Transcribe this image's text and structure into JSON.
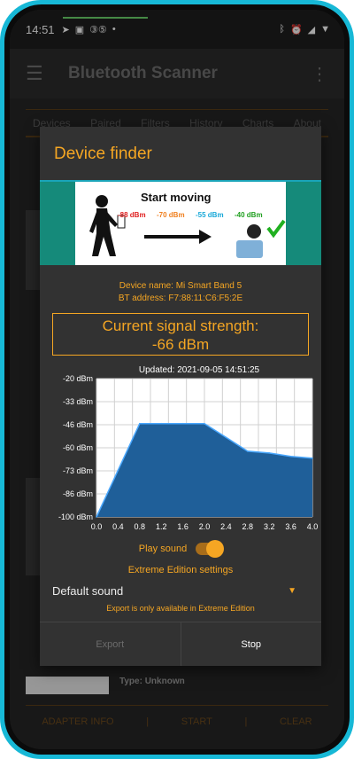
{
  "status_bar": {
    "time": "14:51",
    "left_icons": [
      "send-icon",
      "sim-icon",
      "data-35-icon",
      "dot-icon"
    ],
    "right_icons": [
      "bluetooth-icon",
      "alarm-icon",
      "signal-icon",
      "wifi-icon"
    ]
  },
  "app_bar": {
    "title": "Bluetooth Scanner"
  },
  "tabs": [
    "Devices",
    "Paired",
    "Filters",
    "History",
    "Charts",
    "About"
  ],
  "bottom_bar": {
    "adapter_info": "ADAPTER INFO",
    "start": "START",
    "clear": "CLEAR"
  },
  "background": {
    "type_label": "Type: Unknown"
  },
  "dialog": {
    "title": "Device finder",
    "banner": {
      "heading": "Start moving",
      "dbm_values": [
        "-88 dBm",
        "-70 dBm",
        "-55 dBm",
        "-40 dBm"
      ],
      "dbm_colors": [
        "#e02020",
        "#f08020",
        "#18a8d8",
        "#20a020"
      ]
    },
    "device_name": "Device name: Mi Smart Band 5",
    "bt_address": "BT address: F7:88:11:C6:F5:2E",
    "signal_label": "Current signal strength:",
    "signal_value": "-66 dBm",
    "play_sound_label": "Play sound",
    "play_sound_on": true,
    "extreme_settings": "Extreme Edition settings",
    "sound_selected": "Default sound",
    "export_note": "Export is only available in Extreme Edition",
    "export_button": "Export",
    "stop_button": "Stop"
  },
  "chart_data": {
    "type": "area",
    "title": "Updated: 2021-09-05 14:51:25",
    "x": [
      0.0,
      0.4,
      0.8,
      1.2,
      1.6,
      2.0,
      2.4,
      2.8,
      3.2,
      3.6,
      4.0
    ],
    "y_ticks": [
      "-20 dBm",
      "-33 dBm",
      "-46 dBm",
      "-60 dBm",
      "-73 dBm",
      "-86 dBm",
      "-100 dBm"
    ],
    "x_ticks": [
      "0.0",
      "0.4",
      "0.8",
      "1.2",
      "1.6",
      "2.0",
      "2.4",
      "2.8",
      "3.2",
      "3.6",
      "4.0"
    ],
    "ylim": [
      -100,
      -20
    ],
    "xlim": [
      0.0,
      4.0
    ],
    "series": [
      {
        "values": [
          -100,
          -73,
          -46,
          -46,
          -46,
          -46,
          -54,
          -62,
          -63,
          -65,
          -66
        ]
      }
    ],
    "grid": true,
    "fill_color": "#1f5f99",
    "line_color": "#4aa8ff"
  }
}
